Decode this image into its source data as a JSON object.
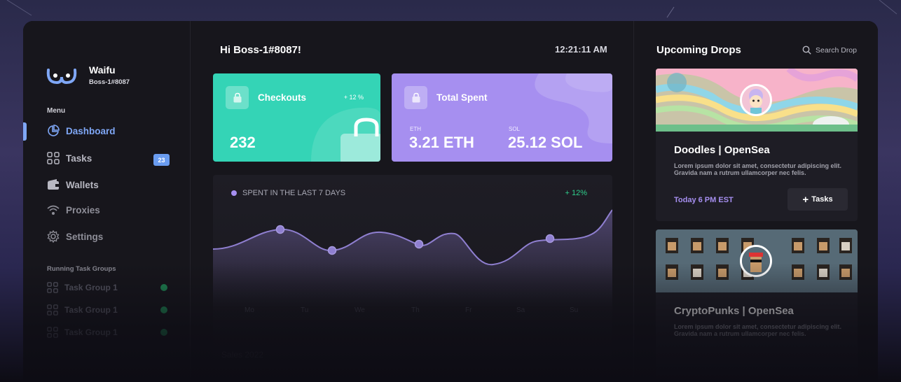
{
  "user": {
    "greeting": "Hi Boss-1#8087!",
    "time": "12:21:11 AM"
  },
  "brand": {
    "name": "Waifu",
    "user": "Boss-1#8087"
  },
  "sidebar": {
    "menu_label": "Menu",
    "items": [
      {
        "label": "Dashboard",
        "icon": "pie-chart-icon",
        "active": true
      },
      {
        "label": "Tasks",
        "icon": "grid-icon",
        "badge": "23"
      },
      {
        "label": "Wallets",
        "icon": "wallet-icon"
      },
      {
        "label": "Proxies",
        "icon": "wifi-icon"
      },
      {
        "label": "Settings",
        "icon": "gear-icon"
      }
    ],
    "running_label": "Running Task Groups",
    "task_groups": [
      {
        "label": "Task Group 1"
      },
      {
        "label": "Task Group 1"
      },
      {
        "label": "Task Group 1"
      }
    ]
  },
  "cards": {
    "checkouts": {
      "title": "Checkouts",
      "pct": "+ 12 %",
      "value": "232",
      "color": "#34d4b6"
    },
    "spent": {
      "title": "Total Spent",
      "eth_label": "ETH",
      "eth_value": "3.21 ETH",
      "sol_label": "SOL",
      "sol_value": "25.12 SOL",
      "color": "#a68ff0"
    }
  },
  "chart": {
    "title": "SPENT IN THE LAST 7 DAYS",
    "pct": "+ 12%",
    "days": [
      "Mo",
      "Tu",
      "We",
      "Th",
      "Fr",
      "Sa",
      "Su"
    ]
  },
  "sales_label": "Sales 2022",
  "right": {
    "title": "Upcoming Drops",
    "search_label": "Search Drop",
    "drops": [
      {
        "title": "Doodles |  OpenSea",
        "desc": "Lorem ipsum dolor sit amet, consectetur adipiscing elit. Gravida nam a rutrum ullamcorper nec felis.",
        "time": "Today 6 PM EST",
        "button": "Tasks"
      },
      {
        "title": "CryptoPunks |  OpenSea",
        "desc": "Lorem ipsum dolor sit amet, consectetur adipiscing elit. Gravida nam a rutrum ullamcorper nec felis."
      }
    ]
  }
}
